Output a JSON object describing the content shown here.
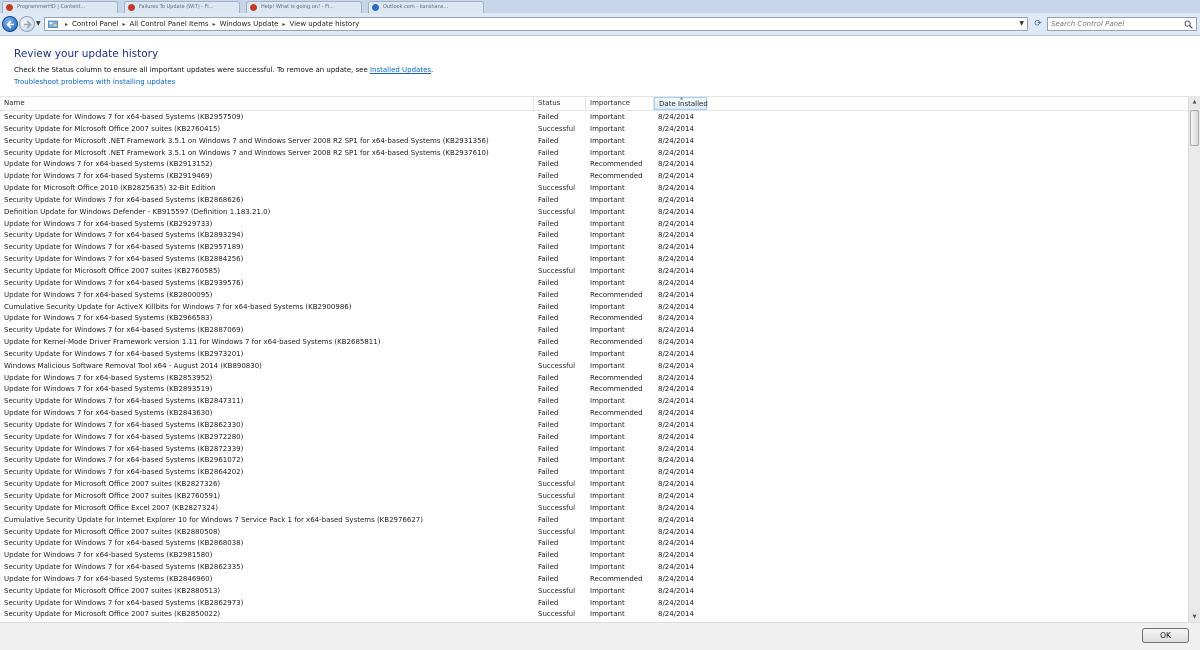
{
  "browser_tabs": [
    {
      "label": "ProgrammerHD | Content...",
      "color": "#c0392b"
    },
    {
      "label": "Failures To Update (WI7) - Fi...",
      "color": "#c0392b"
    },
    {
      "label": "Help! What is going on! - Fi...",
      "color": "#c0392b"
    },
    {
      "label": "Outlook.com - kanshans...",
      "color": "#2b6cc4"
    }
  ],
  "address_bar": {
    "breadcrumbs": [
      "Control Panel",
      "All Control Panel Items",
      "Windows Update",
      "View update history"
    ],
    "search_placeholder": "Search Control Panel"
  },
  "header": {
    "title": "Review your update history",
    "description": "Check the Status column to ensure all important updates were successful. To remove an update, see ",
    "description_link": "Installed Updates",
    "description_end": ".",
    "troubleshoot_link": "Troubleshoot problems with installing updates"
  },
  "columns": {
    "name": "Name",
    "status": "Status",
    "importance": "Importance",
    "date": "Date Installed"
  },
  "updates": [
    {
      "name": "Security Update for Windows 7 for x64-based Systems (KB2957509)",
      "status": "Failed",
      "importance": "Important",
      "date": "8/24/2014"
    },
    {
      "name": "Security Update for Microsoft Office 2007 suites (KB2760415)",
      "status": "Successful",
      "importance": "Important",
      "date": "8/24/2014"
    },
    {
      "name": "Security Update for Microsoft .NET Framework 3.5.1 on Windows 7 and Windows Server 2008 R2 SP1 for x64-based Systems (KB2931356)",
      "status": "Failed",
      "importance": "Important",
      "date": "8/24/2014"
    },
    {
      "name": "Security Update for Microsoft .NET Framework 3.5.1 on Windows 7 and Windows Server 2008 R2 SP1 for x64-based Systems (KB2937610)",
      "status": "Failed",
      "importance": "Important",
      "date": "8/24/2014"
    },
    {
      "name": "Update for Windows 7 for x64-based Systems (KB2913152)",
      "status": "Failed",
      "importance": "Recommended",
      "date": "8/24/2014"
    },
    {
      "name": "Update for Windows 7 for x64-based Systems (KB2919469)",
      "status": "Failed",
      "importance": "Recommended",
      "date": "8/24/2014"
    },
    {
      "name": "Update for Microsoft Office 2010 (KB2825635) 32-Bit Edition",
      "status": "Successful",
      "importance": "Important",
      "date": "8/24/2014"
    },
    {
      "name": "Security Update for Windows 7 for x64-based Systems (KB2868626)",
      "status": "Failed",
      "importance": "Important",
      "date": "8/24/2014"
    },
    {
      "name": "Definition Update for Windows Defender - KB915597 (Definition 1.183.21.0)",
      "status": "Successful",
      "importance": "Important",
      "date": "8/24/2014"
    },
    {
      "name": "Update for Windows 7 for x64-based Systems (KB2929733)",
      "status": "Failed",
      "importance": "Important",
      "date": "8/24/2014"
    },
    {
      "name": "Security Update for Windows 7 for x64-based Systems (KB2893294)",
      "status": "Failed",
      "importance": "Important",
      "date": "8/24/2014"
    },
    {
      "name": "Security Update for Windows 7 for x64-based Systems (KB2957189)",
      "status": "Failed",
      "importance": "Important",
      "date": "8/24/2014"
    },
    {
      "name": "Security Update for Windows 7 for x64-based Systems (KB2884256)",
      "status": "Failed",
      "importance": "Important",
      "date": "8/24/2014"
    },
    {
      "name": "Security Update for Microsoft Office 2007 suites (KB2760585)",
      "status": "Successful",
      "importance": "Important",
      "date": "8/24/2014"
    },
    {
      "name": "Security Update for Windows 7 for x64-based Systems (KB2939576)",
      "status": "Failed",
      "importance": "Important",
      "date": "8/24/2014"
    },
    {
      "name": "Update for Windows 7 for x64-based Systems (KB2800095)",
      "status": "Failed",
      "importance": "Recommended",
      "date": "8/24/2014"
    },
    {
      "name": "Cumulative Security Update for ActiveX Killbits for Windows 7 for x64-based Systems (KB2900986)",
      "status": "Failed",
      "importance": "Important",
      "date": "8/24/2014"
    },
    {
      "name": "Update for Windows 7 for x64-based Systems (KB2966583)",
      "status": "Failed",
      "importance": "Recommended",
      "date": "8/24/2014"
    },
    {
      "name": "Security Update for Windows 7 for x64-based Systems (KB2887069)",
      "status": "Failed",
      "importance": "Important",
      "date": "8/24/2014"
    },
    {
      "name": "Update for Kernel-Mode Driver Framework version 1.11 for Windows 7 for x64-based Systems (KB2685811)",
      "status": "Failed",
      "importance": "Recommended",
      "date": "8/24/2014"
    },
    {
      "name": "Security Update for Windows 7 for x64-based Systems (KB2973201)",
      "status": "Failed",
      "importance": "Important",
      "date": "8/24/2014"
    },
    {
      "name": "Windows Malicious Software Removal Tool x64 - August 2014 (KB890830)",
      "status": "Successful",
      "importance": "Important",
      "date": "8/24/2014"
    },
    {
      "name": "Update for Windows 7 for x64-based Systems (KB2853952)",
      "status": "Failed",
      "importance": "Recommended",
      "date": "8/24/2014"
    },
    {
      "name": "Update for Windows 7 for x64-based Systems (KB2893519)",
      "status": "Failed",
      "importance": "Recommended",
      "date": "8/24/2014"
    },
    {
      "name": "Security Update for Windows 7 for x64-based Systems (KB2847311)",
      "status": "Failed",
      "importance": "Important",
      "date": "8/24/2014"
    },
    {
      "name": "Update for Windows 7 for x64-based Systems (KB2843630)",
      "status": "Failed",
      "importance": "Recommended",
      "date": "8/24/2014"
    },
    {
      "name": "Security Update for Windows 7 for x64-based Systems (KB2862330)",
      "status": "Failed",
      "importance": "Important",
      "date": "8/24/2014"
    },
    {
      "name": "Security Update for Windows 7 for x64-based Systems (KB2972280)",
      "status": "Failed",
      "importance": "Important",
      "date": "8/24/2014"
    },
    {
      "name": "Security Update for Windows 7 for x64-based Systems (KB2872339)",
      "status": "Failed",
      "importance": "Important",
      "date": "8/24/2014"
    },
    {
      "name": "Security Update for Windows 7 for x64-based Systems (KB2961072)",
      "status": "Failed",
      "importance": "Important",
      "date": "8/24/2014"
    },
    {
      "name": "Security Update for Windows 7 for x64-based Systems (KB2864202)",
      "status": "Failed",
      "importance": "Important",
      "date": "8/24/2014"
    },
    {
      "name": "Security Update for Microsoft Office 2007 suites (KB2827326)",
      "status": "Successful",
      "importance": "Important",
      "date": "8/24/2014"
    },
    {
      "name": "Security Update for Microsoft Office 2007 suites (KB2760591)",
      "status": "Successful",
      "importance": "Important",
      "date": "8/24/2014"
    },
    {
      "name": "Security Update for Microsoft Office Excel 2007 (KB2827324)",
      "status": "Successful",
      "importance": "Important",
      "date": "8/24/2014"
    },
    {
      "name": "Cumulative Security Update for Internet Explorer 10 for Windows 7 Service Pack 1 for x64-based Systems (KB2976627)",
      "status": "Failed",
      "importance": "Important",
      "date": "8/24/2014"
    },
    {
      "name": "Security Update for Microsoft Office 2007 suites (KB2880508)",
      "status": "Successful",
      "importance": "Important",
      "date": "8/24/2014"
    },
    {
      "name": "Security Update for Windows 7 for x64-based Systems (KB2868038)",
      "status": "Failed",
      "importance": "Important",
      "date": "8/24/2014"
    },
    {
      "name": "Update for Windows 7 for x64-based Systems (KB2981580)",
      "status": "Failed",
      "importance": "Important",
      "date": "8/24/2014"
    },
    {
      "name": "Security Update for Windows 7 for x64-based Systems (KB2862335)",
      "status": "Failed",
      "importance": "Important",
      "date": "8/24/2014"
    },
    {
      "name": "Update for Windows 7 for x64-based Systems (KB2846960)",
      "status": "Failed",
      "importance": "Recommended",
      "date": "8/24/2014"
    },
    {
      "name": "Security Update for Microsoft Office 2007 suites (KB2880513)",
      "status": "Successful",
      "importance": "Important",
      "date": "8/24/2014"
    },
    {
      "name": "Security Update for Windows 7 for x64-based Systems (KB2862973)",
      "status": "Failed",
      "importance": "Important",
      "date": "8/24/2014"
    },
    {
      "name": "Security Update for Microsoft Office 2007 suites (KB2850022)",
      "status": "Successful",
      "importance": "Important",
      "date": "8/24/2014"
    }
  ],
  "footer": {
    "ok_label": "OK"
  },
  "icons": {
    "back": "back-arrow-icon",
    "forward": "forward-arrow-icon",
    "refresh": "refresh-icon",
    "search": "search-icon",
    "folder": "control-panel-icon"
  },
  "colors": {
    "title": "#1e3287",
    "link": "#0b66c3",
    "sorted_column": "#dcebfc"
  }
}
